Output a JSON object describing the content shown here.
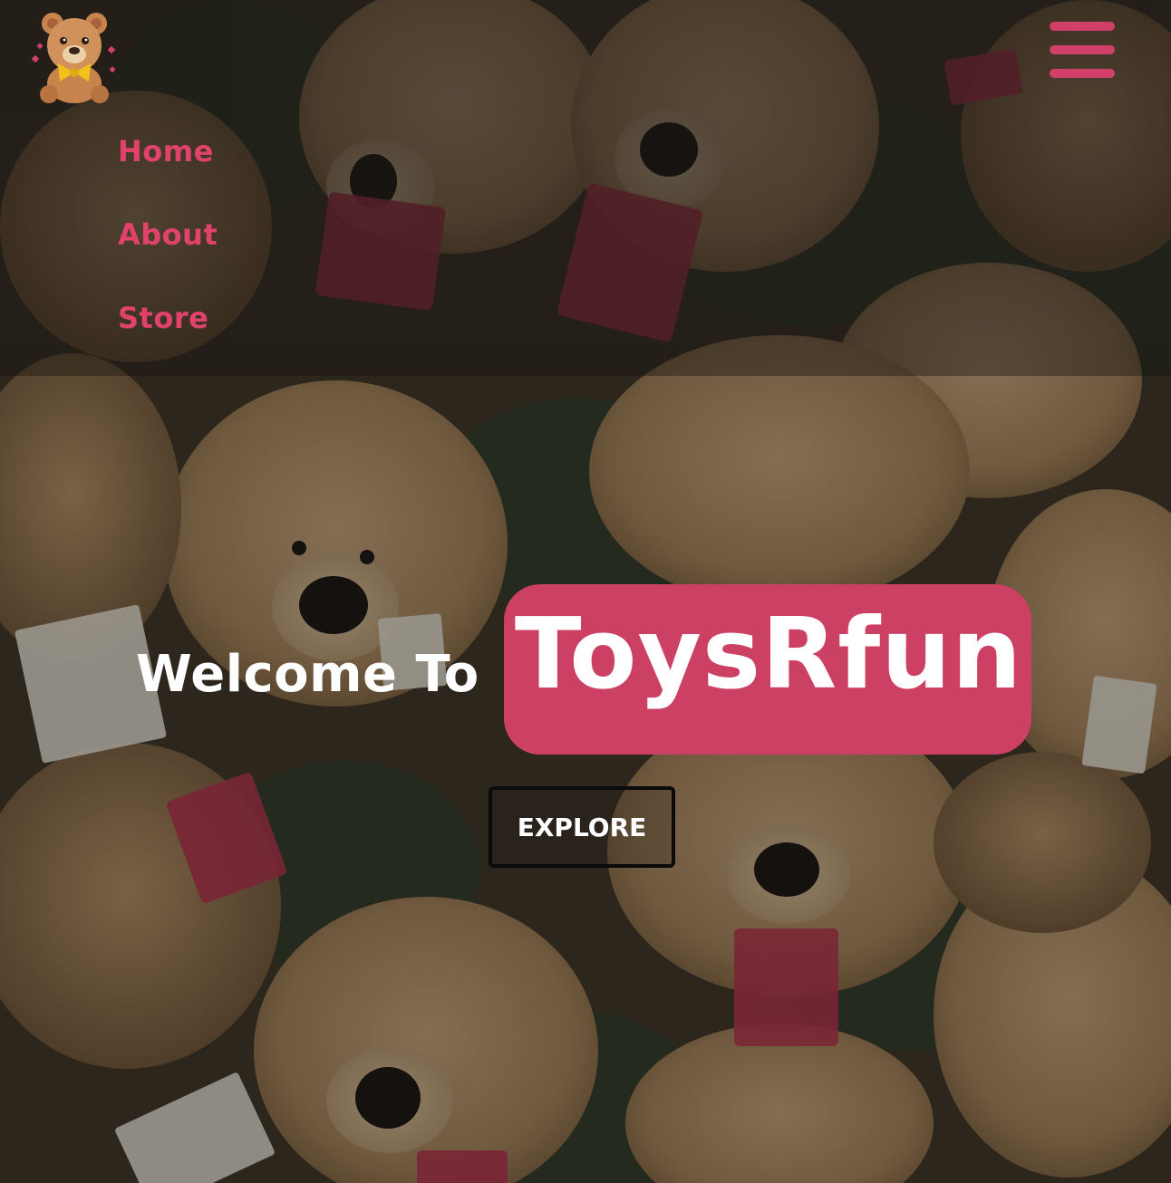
{
  "nav": {
    "logo_alt": "teddy bear logo",
    "menu_icon": "hamburger-menu-icon",
    "items": [
      {
        "label": "Home"
      },
      {
        "label": "About"
      },
      {
        "label": "Store"
      }
    ]
  },
  "hero": {
    "welcome": "Welcome To",
    "brand": "ToysRfun",
    "cta_label": "EXPLORE"
  },
  "colors": {
    "accent": "#cc4064",
    "nav_text": "#e0426c",
    "hero_text": "#ffffff"
  }
}
